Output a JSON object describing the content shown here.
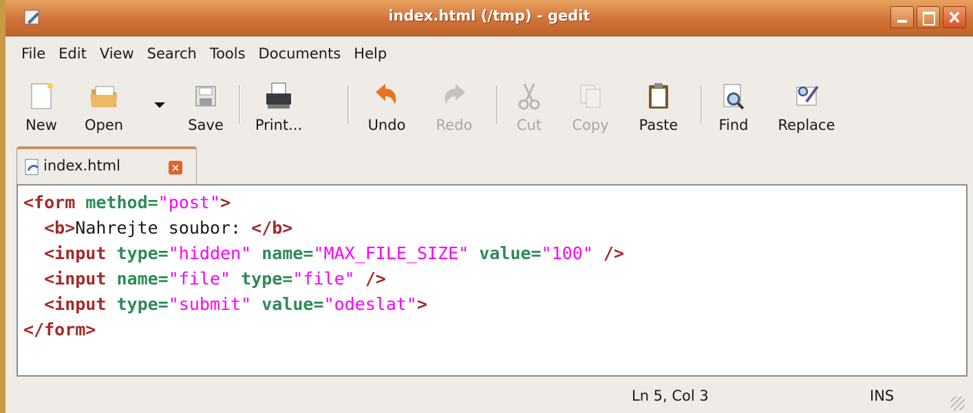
{
  "window": {
    "title": "index.html (/tmp) - gedit"
  },
  "menu": {
    "items": [
      "File",
      "Edit",
      "View",
      "Search",
      "Tools",
      "Documents",
      "Help"
    ]
  },
  "toolbar": {
    "new": "New",
    "open": "Open",
    "save": "Save",
    "print": "Print...",
    "undo": "Undo",
    "redo": "Redo",
    "cut": "Cut",
    "copy": "Copy",
    "paste": "Paste",
    "find": "Find",
    "replace": "Replace"
  },
  "tab": {
    "label": "index.html",
    "close": "×"
  },
  "code": {
    "l1": [
      "<form ",
      "method=",
      "\"post\"",
      ">"
    ],
    "l2": [
      "  <b>",
      "Nahrejte soubor: ",
      "</b>"
    ],
    "l3": [
      "  <input ",
      "type=",
      "\"hidden\"",
      " name=",
      "\"MAX_FILE_SIZE\"",
      " value=",
      "\"100\"",
      " />"
    ],
    "l4": [
      "  <input ",
      "name=",
      "\"file\"",
      " type=",
      "\"file\"",
      " />"
    ],
    "l5": [
      "  <input ",
      "type=",
      "\"submit\"",
      " value=",
      "\"odeslat\"",
      ">"
    ],
    "l6": [
      "</form>"
    ]
  },
  "status": {
    "position": "Ln 5, Col 3",
    "mode": "INS"
  },
  "colors": {
    "titlebar": "#d0723a",
    "tag": "#a52a2a",
    "attribute": "#2e8b57",
    "value": "#ff00ff",
    "desktop": "#d6ad55"
  }
}
